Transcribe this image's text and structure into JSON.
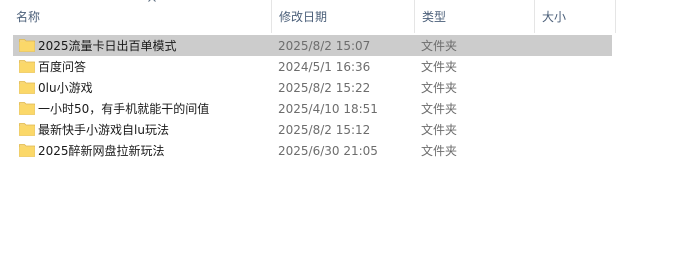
{
  "columns": {
    "name": "名称",
    "date": "修改日期",
    "type": "类型",
    "size": "大小"
  },
  "sort_icon": "chevron-up-icon",
  "folder_icon": "folder-icon",
  "colors": {
    "selection": "#cccccc",
    "folder": "#f8d775",
    "header_text": "#4c607a"
  },
  "rows": [
    {
      "name": "2025流量卡日出百单模式",
      "date": "2025/8/2 15:07",
      "type": "文件夹",
      "size": "",
      "selected": true
    },
    {
      "name": "百度问答",
      "date": "2024/5/1 16:36",
      "type": "文件夹",
      "size": "",
      "selected": false
    },
    {
      "name": "0lu小游戏",
      "date": "2025/8/2 15:22",
      "type": "文件夹",
      "size": "",
      "selected": false
    },
    {
      "name": "一小时50，有手机就能干的间值",
      "date": "2025/4/10 18:51",
      "type": "文件夹",
      "size": "",
      "selected": false
    },
    {
      "name": "最新快手小游戏自lu玩法",
      "date": "2025/8/2 15:12",
      "type": "文件夹",
      "size": "",
      "selected": false
    },
    {
      "name": "2025醉新网盘拉新玩法",
      "date": "2025/6/30 21:05",
      "type": "文件夹",
      "size": "",
      "selected": false
    }
  ]
}
